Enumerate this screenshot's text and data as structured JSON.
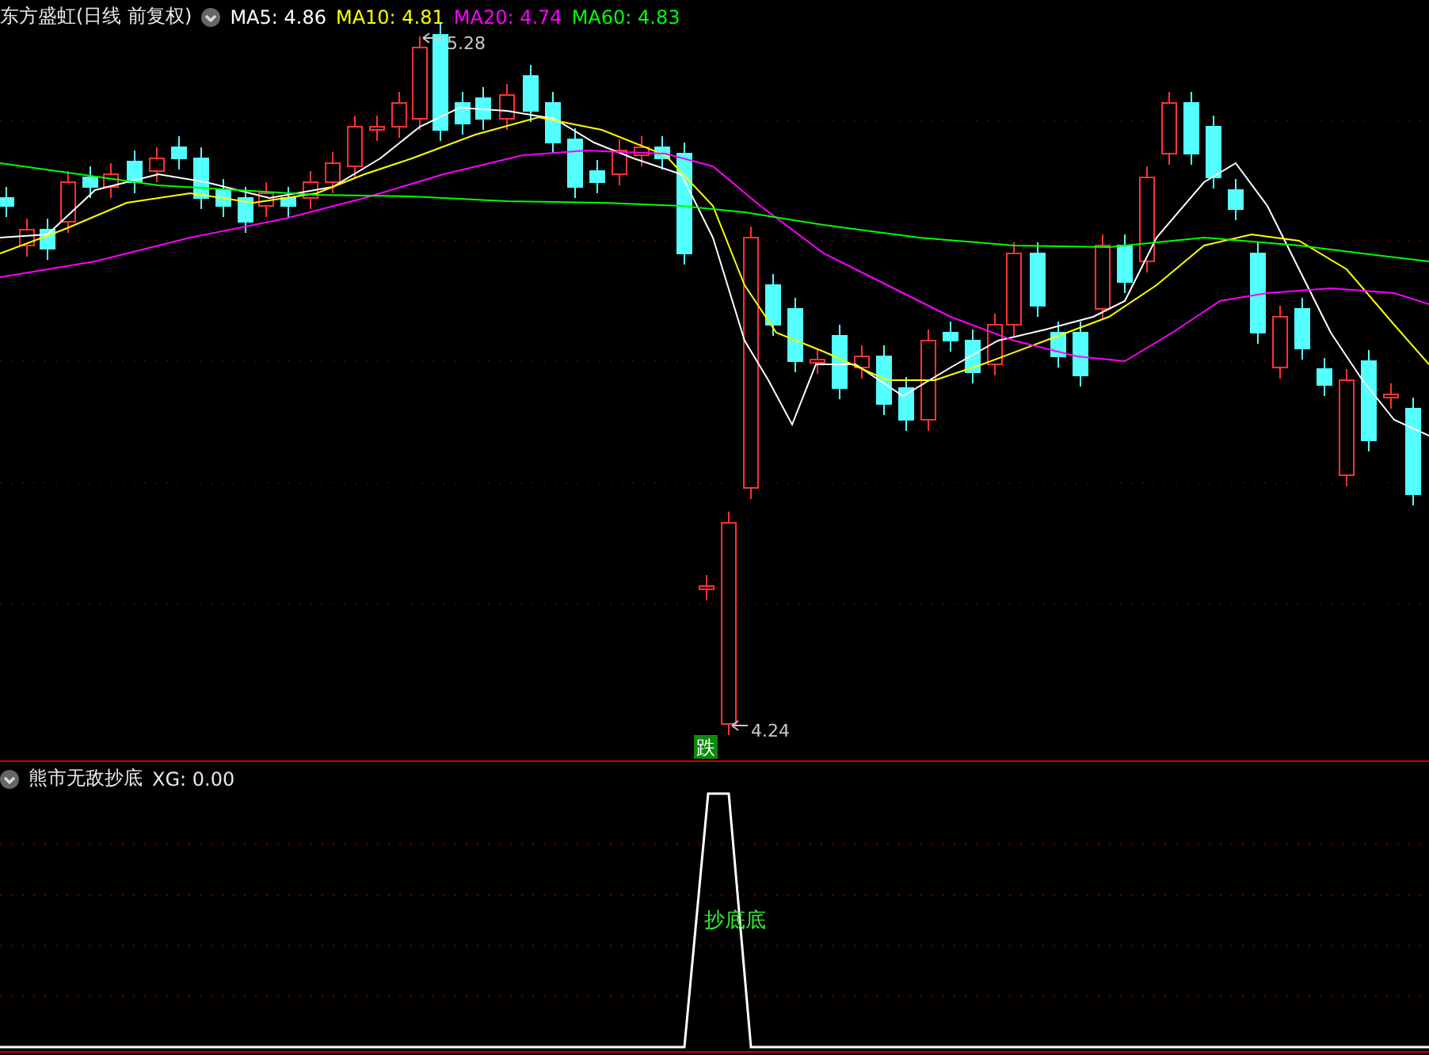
{
  "title": "东方盛虹(日线 前复权)",
  "indicators": [
    {
      "label": "MA5:",
      "value": "4.86",
      "color": "#ffffff"
    },
    {
      "label": "MA10:",
      "value": "4.81",
      "color": "#ffff00"
    },
    {
      "label": "MA20:",
      "value": "4.74",
      "color": "#ff00ff"
    },
    {
      "label": "MA60:",
      "value": "4.83",
      "color": "#00ff00"
    }
  ],
  "price_marks": [
    {
      "kind": "high",
      "text": "5.28"
    },
    {
      "kind": "low",
      "text": "4.24"
    }
  ],
  "signal_badge": "跌",
  "sub_panel": {
    "title": "熊市无敌抄底",
    "reading": "XG: 0.00",
    "signal_label": "抄底底"
  }
}
